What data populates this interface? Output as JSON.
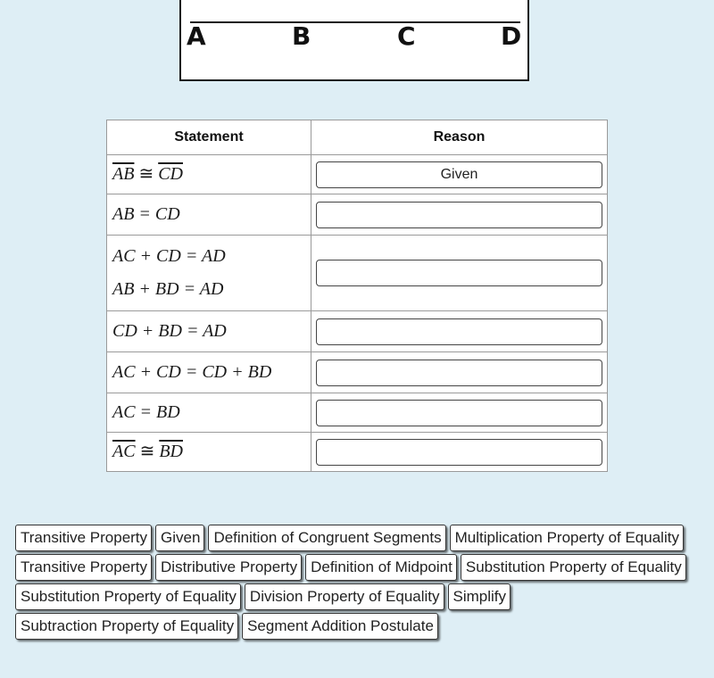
{
  "diagram": {
    "points": [
      "A",
      "B",
      "C",
      "D"
    ]
  },
  "table": {
    "headers": {
      "statement": "Statement",
      "reason": "Reason"
    },
    "rows": [
      {
        "statement_lines": [
          {
            "a": "AB",
            "op": "≅",
            "b": "CD",
            "overline": true
          }
        ],
        "reason": "Given"
      },
      {
        "statement_lines": [
          {
            "text": "AB = CD"
          }
        ],
        "reason": ""
      },
      {
        "statement_lines": [
          {
            "text": "AC + CD = AD"
          },
          {
            "text": "AB + BD = AD"
          }
        ],
        "reason": ""
      },
      {
        "statement_lines": [
          {
            "text": "CD + BD = AD"
          }
        ],
        "reason": ""
      },
      {
        "statement_lines": [
          {
            "text": "AC + CD = CD + BD"
          }
        ],
        "reason": ""
      },
      {
        "statement_lines": [
          {
            "text": "AC = BD"
          }
        ],
        "reason": ""
      },
      {
        "statement_lines": [
          {
            "a": "AC",
            "op": "≅",
            "b": "BD",
            "overline": true
          }
        ],
        "reason": ""
      }
    ]
  },
  "word_bank": [
    "Transitive Property",
    "Given",
    "Definition of Congruent Segments",
    "Multiplication Property of Equality",
    "Transitive Property",
    "Distributive Property",
    "Definition of Midpoint",
    "Substitution Property of Equality",
    "Substitution Property of Equality",
    "Division Property of Equality",
    "Simplify",
    "Subtraction Property of Equality",
    "Segment Addition Postulate"
  ]
}
